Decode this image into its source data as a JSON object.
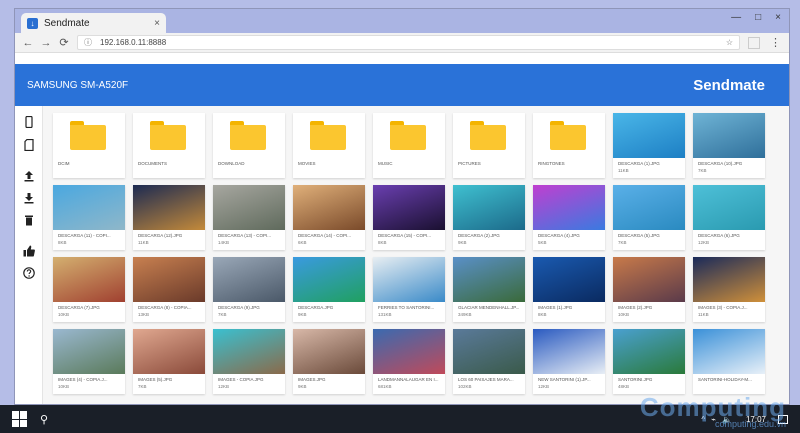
{
  "browser": {
    "tab_title": "Sendmate",
    "tab_close": "×",
    "address": "192.168.0.11:8888",
    "info": "ⓘ",
    "back": "←",
    "forward": "→",
    "reload": "⟳",
    "star": "☆",
    "menu": "⋮",
    "window_buttons": [
      "—",
      "□",
      "×"
    ]
  },
  "app": {
    "device_name": "SAMSUNG SM-A520F",
    "brand": "Sendmate"
  },
  "sidebar": {
    "icons": [
      "phone-icon",
      "sd-card-icon",
      "upload-icon",
      "download-icon",
      "delete-icon",
      "like-icon",
      "help-icon"
    ]
  },
  "items": [
    {
      "name": "DCIM",
      "size": "",
      "kind": "folder"
    },
    {
      "name": "DOCUMENTS",
      "size": "",
      "kind": "folder"
    },
    {
      "name": "DOWNLOAD",
      "size": "",
      "kind": "folder"
    },
    {
      "name": "MOVIES",
      "size": "",
      "kind": "folder"
    },
    {
      "name": "MUSIC",
      "size": "",
      "kind": "folder"
    },
    {
      "name": "PICTURES",
      "size": "",
      "kind": "folder"
    },
    {
      "name": "RINGTONES",
      "size": "",
      "kind": "folder"
    },
    {
      "name": "DESCARGA (1).JPG",
      "size": "11KB",
      "kind": "image",
      "colors": [
        "#4ab6e8",
        "#1d7fc4"
      ]
    },
    {
      "name": "DESCARGA (10).JPG",
      "size": "7KB",
      "kind": "image",
      "colors": [
        "#6fb4d6",
        "#2f6f9a"
      ]
    },
    {
      "name": "DESCARGA (11) - COPI...",
      "size": "8KB",
      "kind": "image",
      "colors": [
        "#4aa8e0",
        "#8fb7c9"
      ]
    },
    {
      "name": "DESCARGA (12).JPG",
      "size": "11KB",
      "kind": "image",
      "colors": [
        "#1c2a52",
        "#c48a3a"
      ]
    },
    {
      "name": "DESCARGA (13) - COPI...",
      "size": "14KB",
      "kind": "image",
      "colors": [
        "#a7a7a0",
        "#5f6a5c"
      ]
    },
    {
      "name": "DESCARGA (14) - COPI...",
      "size": "6KB",
      "kind": "image",
      "colors": [
        "#e0b07a",
        "#7a4a2a"
      ]
    },
    {
      "name": "DESCARGA (15) - COPI...",
      "size": "8KB",
      "kind": "image",
      "colors": [
        "#6a3fb0",
        "#1a1030"
      ]
    },
    {
      "name": "DESCARGA (2).JPG",
      "size": "9KB",
      "kind": "image",
      "colors": [
        "#3fc0d0",
        "#1c6a8a"
      ]
    },
    {
      "name": "DESCARGA (4).JPG",
      "size": "5KB",
      "kind": "image",
      "colors": [
        "#c03fd0",
        "#3a7ae0"
      ]
    },
    {
      "name": "DESCARGA (5).JPG",
      "size": "7KB",
      "kind": "image",
      "colors": [
        "#5ab0e8",
        "#2a8ac0"
      ]
    },
    {
      "name": "DESCARGA (6).JPG",
      "size": "12KB",
      "kind": "image",
      "colors": [
        "#4ec0d8",
        "#2a9ab0"
      ]
    },
    {
      "name": "DESCARGA (7).JPG",
      "size": "10KB",
      "kind": "image",
      "colors": [
        "#d4b070",
        "#a04030"
      ]
    },
    {
      "name": "DESCARGA (8) - COPIA...",
      "size": "13KB",
      "kind": "image",
      "colors": [
        "#c88050",
        "#6a3a2a"
      ]
    },
    {
      "name": "DESCARGA (9).JPG",
      "size": "7KB",
      "kind": "image",
      "colors": [
        "#9aa8b8",
        "#4a5868"
      ]
    },
    {
      "name": "DESCARGA.JPG",
      "size": "9KB",
      "kind": "image",
      "colors": [
        "#3a9ae0",
        "#20a060"
      ]
    },
    {
      "name": "FERRIES TO SANTORINI...",
      "size": "131KB",
      "kind": "image",
      "colors": [
        "#e8eef2",
        "#3a8ac8"
      ]
    },
    {
      "name": "GLACIAR MENDENHALL.JP...",
      "size": "349KB",
      "kind": "image",
      "colors": [
        "#5a90c8",
        "#3a6a3a"
      ]
    },
    {
      "name": "IMAGES (1).JPG",
      "size": "8KB",
      "kind": "image",
      "colors": [
        "#1a5ab0",
        "#0a2a60"
      ]
    },
    {
      "name": "IMAGES (2).JPG",
      "size": "10KB",
      "kind": "image",
      "colors": [
        "#c87a4a",
        "#5a3a4a"
      ]
    },
    {
      "name": "IMAGES (3) - COPIA.J...",
      "size": "11KB",
      "kind": "image",
      "colors": [
        "#1a2a5a",
        "#d0903a"
      ]
    },
    {
      "name": "IMAGES (4) - COPIA.J...",
      "size": "10KB",
      "kind": "image",
      "colors": [
        "#9ab8d0",
        "#5a7a5a"
      ]
    },
    {
      "name": "IMAGES (5).JPG",
      "size": "7KB",
      "kind": "image",
      "colors": [
        "#e0a890",
        "#8a4a3a"
      ]
    },
    {
      "name": "IMAGES - COPIA.JPG",
      "size": "12KB",
      "kind": "image",
      "colors": [
        "#3ac0d0",
        "#8a6a4a"
      ]
    },
    {
      "name": "IMAGES.JPG",
      "size": "9KB",
      "kind": "image",
      "colors": [
        "#d8b8a8",
        "#6a4a3a"
      ]
    },
    {
      "name": "LANDMANNALAUGAR EN I...",
      "size": "681KB",
      "kind": "image",
      "colors": [
        "#3a6ab0",
        "#c04a5a"
      ]
    },
    {
      "name": "LOS 60 PAISAJES MARA...",
      "size": "102KB",
      "kind": "image",
      "colors": [
        "#5a7a9a",
        "#3a5a4a"
      ]
    },
    {
      "name": "NEW SANTORINI (1).JP...",
      "size": "12KB",
      "kind": "image",
      "colors": [
        "#2a5ac0",
        "#e8eef5"
      ]
    },
    {
      "name": "SANTORINI.JPG",
      "size": "48KB",
      "kind": "image",
      "colors": [
        "#4aa0d0",
        "#2a7a3a"
      ]
    },
    {
      "name": "SANTORINI-HOLIDAY-M...",
      "size": "",
      "kind": "image",
      "colors": [
        "#3a90d8",
        "#e8f0f8"
      ]
    }
  ],
  "taskbar": {
    "search_glyph": "⚲",
    "tray_up": "^",
    "tray_net": "⌁",
    "tray_vol": "🔈",
    "time": "17:07"
  },
  "watermark": {
    "big": "Computing",
    "small": "computing.edu.vn"
  }
}
